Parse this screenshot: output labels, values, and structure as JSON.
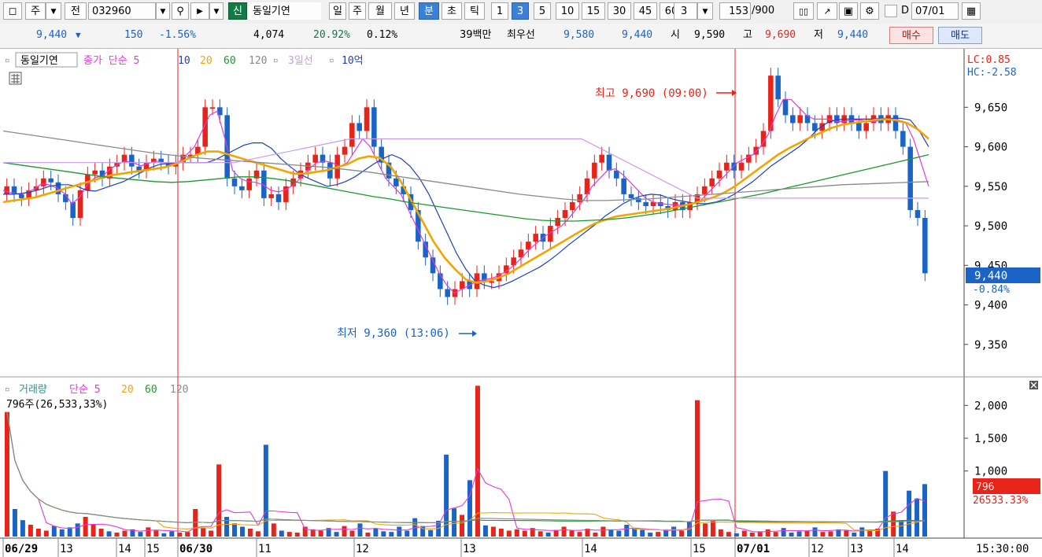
{
  "toolbar": {
    "period_main": "주",
    "prev_label": "전",
    "code": "032960",
    "credit_badge": "신",
    "stock_name": "동일기연",
    "periods": [
      "일",
      "주",
      "월",
      "년",
      "분",
      "초",
      "틱"
    ],
    "active_period": "분",
    "intervals": [
      "1",
      "3",
      "5",
      "10",
      "15",
      "30",
      "45",
      "60"
    ],
    "active_interval": "3",
    "interval_value": "3",
    "count": "153",
    "count_total": "/900",
    "date_flag": "D",
    "date": "07/01"
  },
  "quote": {
    "price": "9,440",
    "change": "150",
    "change_pct": "-1.56%",
    "volume": "4,074",
    "vol_ratio": "20.92%",
    "turnover": "0.12%",
    "amount": "39백만",
    "best_label": "최우선",
    "best_ask": "9,580",
    "best_bid": "9,440",
    "open_label": "시",
    "open": "9,590",
    "high_label": "고",
    "high": "9,690",
    "low_label": "저",
    "low": "9,440",
    "buy_label": "매수",
    "sell_label": "매도"
  },
  "colors": {
    "up": "#e8231a",
    "down": "#1a64c8",
    "ma5": "#e23bd8",
    "ma10": "#1f3fbf",
    "ma20": "#f2a500",
    "ma60": "#1a9a2a",
    "ma120": "#8a8a8a",
    "ma3d": "#c79af0"
  },
  "chart_data": [
    {
      "type": "candlestick",
      "title": "동일기연",
      "legend": [
        {
          "label": "종가 단순 5",
          "color": "#e23bd8"
        },
        {
          "label": "10",
          "color": "#1f3fbf"
        },
        {
          "label": "20",
          "color": "#f2a500"
        },
        {
          "label": "60",
          "color": "#1a9a2a"
        },
        {
          "label": "120",
          "color": "#8a8a8a"
        },
        {
          "label": "3일선",
          "color": "#c79af0"
        },
        {
          "label": "10억",
          "color": "#1f3fbf"
        }
      ],
      "ylim": [
        9310,
        9720
      ],
      "y_ticks": [
        "9,350",
        "9,400",
        "9,450",
        "9,500",
        "9,550",
        "9,600",
        "9,650"
      ],
      "x_ticks": [
        "06/29",
        "13",
        "14",
        "15",
        "06/30",
        "11",
        "12",
        "13",
        "14",
        "15",
        "07/01",
        "12",
        "13",
        "14"
      ],
      "time_label": "15:30:00",
      "annotations": {
        "high": "최고 9,690 (09:00)",
        "low": "최저 9,360 (13:06)",
        "lc": "LC:0.85",
        "hc": "HC:-2.58",
        "last_price": "9,440",
        "last_pct": "-0.84%"
      },
      "series": [
        {
          "name": "close",
          "values": [
            9550,
            9540,
            9535,
            9545,
            9550,
            9560,
            9555,
            9540,
            9530,
            9510,
            9545,
            9565,
            9570,
            9560,
            9575,
            9580,
            9590,
            9575,
            9570,
            9580,
            9585,
            9580,
            9575,
            9580,
            9590,
            9590,
            9600,
            9650,
            9650,
            9640,
            9560,
            9550,
            9545,
            9560,
            9570,
            9535,
            9540,
            9530,
            9550,
            9560,
            9570,
            9580,
            9590,
            9580,
            9560,
            9590,
            9600,
            9630,
            9620,
            9650,
            9600,
            9580,
            9560,
            9550,
            9540,
            9520,
            9480,
            9460,
            9440,
            9420,
            9410,
            9420,
            9430,
            9420,
            9440,
            9430,
            9430,
            9440,
            9450,
            9460,
            9470,
            9480,
            9490,
            9480,
            9500,
            9510,
            9520,
            9530,
            9540,
            9560,
            9580,
            9590,
            9570,
            9560,
            9540,
            9535,
            9530,
            9525,
            9530,
            9525,
            9520,
            9530,
            9520,
            9530,
            9540,
            9550,
            9560,
            9570,
            9580,
            9570,
            9580,
            9590,
            9600,
            9620,
            9690,
            9660,
            9640,
            9630,
            9640,
            9630,
            9620,
            9630,
            9640,
            9630,
            9640,
            9630,
            9620,
            9630,
            9640,
            9630,
            9640,
            9620,
            9600,
            9520,
            9510,
            9440
          ]
        },
        {
          "name": "5",
          "values": [
            9545,
            9542,
            9540,
            9542,
            9546,
            9553,
            9552,
            9548,
            9541,
            9528,
            9536,
            9552,
            9561,
            9563,
            9572,
            9578,
            9582,
            9580,
            9576,
            9579,
            9582,
            9580,
            9578,
            9581,
            9590,
            9600,
            9620,
            9640,
            9645,
            9610,
            9570,
            9560,
            9556,
            9555,
            9552,
            9545,
            9543,
            9546,
            9552,
            9562,
            9572,
            9580,
            9582,
            9580,
            9575,
            9580,
            9595,
            9610,
            9600,
            9580,
            9560,
            9550,
            9540,
            9520,
            9500,
            9480,
            9460,
            9440,
            9425,
            9415,
            9420,
            9425,
            9430,
            9432,
            9434,
            9438,
            9444,
            9452,
            9462,
            9472,
            9480,
            9488,
            9494,
            9500,
            9510,
            9522,
            9534,
            9550,
            9560,
            9570,
            9572,
            9565,
            9555,
            9545,
            9535,
            9530,
            9528,
            9527,
            9526,
            9526,
            9528,
            9530,
            9540,
            9550,
            9560,
            9570,
            9580,
            9585,
            9590,
            9600,
            9615,
            9640,
            9660,
            9660,
            9650,
            9640,
            9635,
            9635,
            9635,
            9632,
            9632,
            9634,
            9634,
            9632,
            9632,
            9634,
            9634,
            9632,
            9630,
            9610,
            9580,
            9550
          ]
        },
        {
          "name": "10",
          "values": [
            9540,
            9540,
            9541,
            9543,
            9546,
            9550,
            9552,
            9552,
            9550,
            9545,
            9544,
            9548,
            9552,
            9556,
            9562,
            9568,
            9574,
            9578,
            9579,
            9580,
            9580,
            9580,
            9580,
            9584,
            9590,
            9596,
            9602,
            9605,
            9605,
            9598,
            9585,
            9575,
            9566,
            9560,
            9555,
            9550,
            9552,
            9556,
            9562,
            9570,
            9578,
            9585,
            9590,
            9585,
            9575,
            9560,
            9540,
            9515,
            9490,
            9465,
            9445,
            9430,
            9425,
            9422,
            9425,
            9430,
            9436,
            9442,
            9448,
            9456,
            9465,
            9475,
            9484,
            9493,
            9502,
            9512,
            9520,
            9528,
            9534,
            9538,
            9540,
            9539,
            9535,
            9532,
            9530,
            9528,
            9528,
            9530,
            9534,
            9540,
            9548,
            9556,
            9566,
            9576,
            9584,
            9592,
            9600,
            9610,
            9622,
            9630,
            9634,
            9635,
            9635,
            9635,
            9635,
            9636,
            9636,
            9636,
            9634,
            9620,
            9600
          ]
        },
        {
          "name": "20",
          "values": [
            9530,
            9532,
            9534,
            9536,
            9540,
            9544,
            9548,
            9552,
            9556,
            9560,
            9564,
            9566,
            9568,
            9570,
            9572,
            9574,
            9578,
            9584,
            9590,
            9594,
            9594,
            9590,
            9586,
            9582,
            9578,
            9574,
            9570,
            9566,
            9566,
            9568,
            9570,
            9574,
            9578,
            9585,
            9588,
            9586,
            9575,
            9555,
            9530,
            9505,
            9480,
            9460,
            9445,
            9432,
            9428,
            9430,
            9434,
            9440,
            9448,
            9456,
            9464,
            9472,
            9480,
            9488,
            9496,
            9503,
            9508,
            9512,
            9514,
            9516,
            9518,
            9520,
            9522,
            9525,
            9528,
            9532,
            9536,
            9542,
            9550,
            9560,
            9570,
            9580,
            9590,
            9598,
            9605,
            9612,
            9618,
            9624,
            9628,
            9630,
            9632,
            9634,
            9635,
            9634,
            9630,
            9622,
            9610
          ]
        },
        {
          "name": "60",
          "values": [
            9580,
            9577,
            9574,
            9571,
            9568,
            9565,
            9562,
            9560,
            9558,
            9556,
            9555,
            9556,
            9558,
            9560,
            9562,
            9562,
            9560,
            9557,
            9553,
            9549,
            9545,
            9541,
            9537,
            9534,
            9530,
            9527,
            9524,
            9521,
            9518,
            9515,
            9512,
            9509,
            9507,
            9506,
            9506,
            9507,
            9508,
            9510,
            9513,
            9516,
            9520,
            9524,
            9528,
            9532,
            9536,
            9540,
            9545,
            9550,
            9555,
            9560,
            9565,
            9570,
            9575,
            9580,
            9585,
            9590
          ]
        },
        {
          "name": "120",
          "values": [
            9620,
            9616,
            9612,
            9608,
            9604,
            9600,
            9596,
            9592,
            9589,
            9586,
            9584,
            9582,
            9580,
            9578,
            9576,
            9574,
            9571,
            9568,
            9564,
            9560,
            9556,
            9552,
            9548,
            9544,
            9540,
            9537,
            9534,
            9532,
            9532,
            9533,
            9534,
            9536,
            9538,
            9540,
            9542,
            9544,
            9546,
            9548,
            9550,
            9552,
            9553,
            9554,
            9555,
            9556
          ]
        },
        {
          "name": "3일선",
          "values": [
            9580,
            9580,
            9580,
            9610,
            9610,
            9610,
            9535,
            9535,
            9535
          ]
        }
      ]
    },
    {
      "type": "bar",
      "title": "거래량",
      "legend": [
        {
          "label": "단순 5",
          "color": "#e23bd8"
        },
        {
          "label": "20",
          "color": "#f2a500"
        },
        {
          "label": "60",
          "color": "#1a9a2a"
        },
        {
          "label": "120",
          "color": "#8a8a8a"
        }
      ],
      "summary": "796주(26,533,33%)",
      "ylim": [
        0,
        2400
      ],
      "y_ticks": [
        "2,000",
        "1,500",
        "1,000"
      ],
      "last_volume": "796",
      "last_volume_pct": "26533.33%",
      "values": [
        1900,
        420,
        250,
        180,
        120,
        90,
        160,
        110,
        140,
        200,
        300,
        180,
        120,
        80,
        60,
        90,
        110,
        70,
        140,
        90,
        50,
        80,
        60,
        70,
        420,
        130,
        90,
        1100,
        300,
        200,
        150,
        120,
        80,
        1400,
        200,
        90,
        70,
        60,
        150,
        110,
        90,
        130,
        70,
        160,
        90,
        200,
        60,
        120,
        80,
        70,
        150,
        90,
        280,
        160,
        100,
        240,
        1250,
        430,
        330,
        860,
        2300,
        170,
        150,
        120,
        90,
        110,
        90,
        130,
        80,
        60,
        100,
        150,
        90,
        70,
        120,
        60,
        150,
        110,
        90,
        180,
        120,
        100,
        60,
        70,
        110,
        150,
        90,
        220,
        2080,
        200,
        240,
        110,
        70,
        50,
        90,
        60,
        80,
        110,
        70,
        130,
        60,
        80,
        90,
        140,
        70,
        80,
        110,
        90,
        60,
        140,
        100,
        120,
        1000,
        380,
        250,
        700,
        580,
        800
      ]
    }
  ]
}
